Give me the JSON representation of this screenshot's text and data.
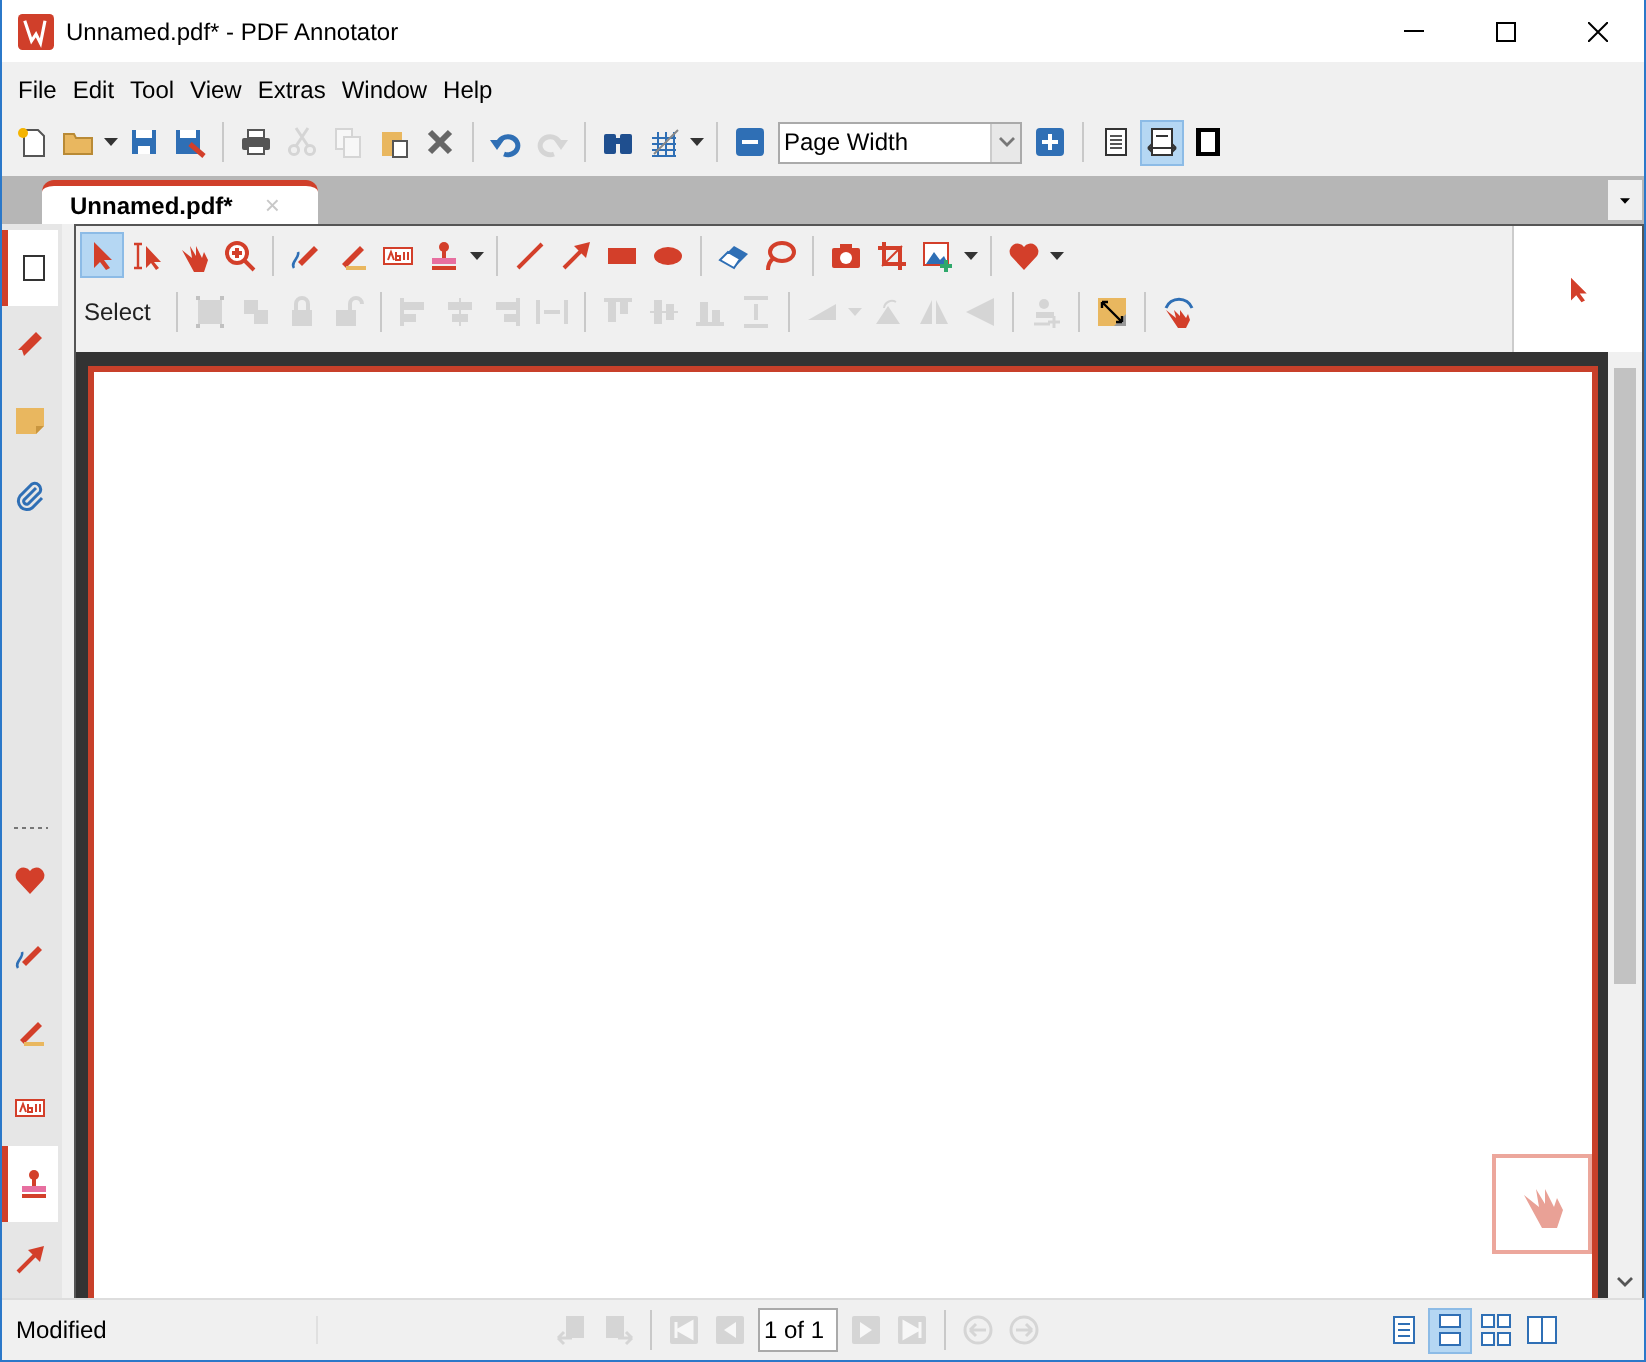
{
  "window": {
    "title": "Unnamed.pdf* - PDF Annotator"
  },
  "menu": [
    "File",
    "Edit",
    "Tool",
    "View",
    "Extras",
    "Window",
    "Help"
  ],
  "toolbar": [
    {
      "kind": "new",
      "disabled": false
    },
    {
      "kind": "open",
      "disabled": false
    },
    {
      "kind": "dropdown",
      "disabled": false
    },
    {
      "kind": "save",
      "disabled": false
    },
    {
      "kind": "save-as",
      "disabled": false
    },
    {
      "kind": "separator"
    },
    {
      "kind": "print",
      "disabled": false
    },
    {
      "kind": "cut",
      "disabled": true
    },
    {
      "kind": "copy",
      "disabled": true
    },
    {
      "kind": "paste",
      "disabled": false
    },
    {
      "kind": "delete",
      "disabled": false
    },
    {
      "kind": "separator"
    },
    {
      "kind": "undo",
      "disabled": false
    },
    {
      "kind": "redo",
      "disabled": true
    },
    {
      "kind": "separator"
    },
    {
      "kind": "find",
      "disabled": false
    },
    {
      "kind": "grid",
      "disabled": false
    },
    {
      "kind": "dropdown",
      "disabled": false
    },
    {
      "kind": "separator"
    },
    {
      "kind": "zoom-out",
      "disabled": false
    },
    {
      "kind": "zoom-select",
      "value": "Page Width"
    },
    {
      "kind": "zoom-in",
      "disabled": false
    },
    {
      "kind": "separator"
    },
    {
      "kind": "page-single",
      "disabled": false,
      "selected": false
    },
    {
      "kind": "page-width",
      "disabled": false,
      "selected": true
    },
    {
      "kind": "fullscreen",
      "disabled": false,
      "selected": false
    }
  ],
  "document_tab": {
    "label": "Unnamed.pdf*",
    "close": "×"
  },
  "sidebar_top": [
    {
      "kind": "page",
      "selected": true
    },
    {
      "kind": "bookmark",
      "selected": false
    },
    {
      "kind": "note",
      "selected": false
    },
    {
      "kind": "clip",
      "selected": false
    }
  ],
  "sidebar_bottom": [
    {
      "kind": "heart",
      "selected": false
    },
    {
      "kind": "pen",
      "selected": false
    },
    {
      "kind": "highlighter",
      "selected": false
    },
    {
      "kind": "textbox",
      "selected": false
    },
    {
      "kind": "stamp",
      "selected": true
    },
    {
      "kind": "arrow",
      "selected": false
    }
  ],
  "tools": [
    {
      "kind": "select",
      "disabled": false,
      "selected": true
    },
    {
      "kind": "text-select",
      "disabled": false,
      "selected": false
    },
    {
      "kind": "hand",
      "disabled": false,
      "selected": false
    },
    {
      "kind": "zoom",
      "disabled": false,
      "selected": false
    },
    {
      "kind": "separator"
    },
    {
      "kind": "pen",
      "disabled": false,
      "selected": false
    },
    {
      "kind": "highlighter",
      "disabled": false,
      "selected": false
    },
    {
      "kind": "textbox",
      "disabled": false,
      "selected": false
    },
    {
      "kind": "stamp",
      "disabled": false,
      "selected": false
    },
    {
      "kind": "dropdown",
      "disabled": false
    },
    {
      "kind": "separator"
    },
    {
      "kind": "line",
      "disabled": false,
      "selected": false
    },
    {
      "kind": "arrow",
      "disabled": false,
      "selected": false
    },
    {
      "kind": "rect",
      "disabled": false,
      "selected": false
    },
    {
      "kind": "ellipse",
      "disabled": false,
      "selected": false
    },
    {
      "kind": "separator"
    },
    {
      "kind": "eraser",
      "disabled": false,
      "selected": false
    },
    {
      "kind": "lasso",
      "disabled": false,
      "selected": false
    },
    {
      "kind": "separator"
    },
    {
      "kind": "camera",
      "disabled": false,
      "selected": false
    },
    {
      "kind": "crop",
      "disabled": false,
      "selected": false
    },
    {
      "kind": "image",
      "disabled": false,
      "selected": false
    },
    {
      "kind": "dropdown",
      "disabled": false
    },
    {
      "kind": "separator"
    },
    {
      "kind": "heart",
      "disabled": false,
      "selected": false
    },
    {
      "kind": "dropdown",
      "disabled": false
    }
  ],
  "tool_options": [
    {
      "kind": "label",
      "text": "Select"
    },
    {
      "kind": "separator"
    },
    {
      "kind": "group",
      "disabled": true
    },
    {
      "kind": "ungroup",
      "disabled": true
    },
    {
      "kind": "lock",
      "disabled": true
    },
    {
      "kind": "unlock",
      "disabled": true
    },
    {
      "kind": "separator"
    },
    {
      "kind": "align-left",
      "disabled": true
    },
    {
      "kind": "align-center",
      "disabled": true
    },
    {
      "kind": "align-right",
      "disabled": true
    },
    {
      "kind": "distribute",
      "disabled": true
    },
    {
      "kind": "separator"
    },
    {
      "kind": "align-top",
      "disabled": true
    },
    {
      "kind": "align-middle",
      "disabled": true
    },
    {
      "kind": "align-bottom",
      "disabled": true
    },
    {
      "kind": "spacing",
      "disabled": true
    },
    {
      "kind": "separator"
    },
    {
      "kind": "rotate",
      "disabled": true
    },
    {
      "kind": "dropdown",
      "disabled": true
    },
    {
      "kind": "rotate-free",
      "disabled": true
    },
    {
      "kind": "flip-h",
      "disabled": true
    },
    {
      "kind": "flip-v",
      "disabled": true
    },
    {
      "kind": "separator"
    },
    {
      "kind": "add-user",
      "disabled": true
    },
    {
      "kind": "separator"
    },
    {
      "kind": "resize",
      "disabled": false
    },
    {
      "kind": "separator"
    },
    {
      "kind": "wave",
      "disabled": false
    }
  ],
  "status_bar": {
    "text": "Modified",
    "navigation": [
      {
        "kind": "nav-back",
        "disabled": true
      },
      {
        "kind": "nav-forward",
        "disabled": true
      },
      {
        "kind": "separator"
      },
      {
        "kind": "first",
        "disabled": true
      },
      {
        "kind": "prev",
        "disabled": true
      },
      {
        "kind": "page-field",
        "value": "1 of 1"
      },
      {
        "kind": "next",
        "disabled": true
      },
      {
        "kind": "last",
        "disabled": true
      },
      {
        "kind": "separator"
      },
      {
        "kind": "history-back",
        "disabled": true
      },
      {
        "kind": "history-forward",
        "disabled": true
      }
    ],
    "layouts": [
      {
        "kind": "layout-single",
        "selected": false
      },
      {
        "kind": "layout-continuous",
        "selected": true
      },
      {
        "kind": "layout-two",
        "selected": false
      },
      {
        "kind": "layout-book",
        "selected": false
      }
    ]
  }
}
